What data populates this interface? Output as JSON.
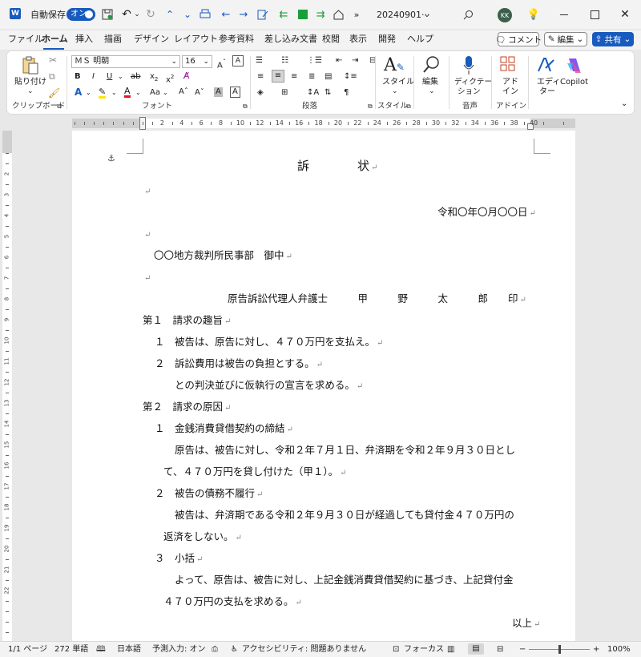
{
  "titlebar": {
    "autosave_label": "自動保存",
    "autosave_state": "オン",
    "doc_name": "20240901···",
    "avatar": "KK",
    "app_icon": "word-icon"
  },
  "tabs": [
    {
      "label": "ファイル"
    },
    {
      "label": "ホーム"
    },
    {
      "label": "挿入"
    },
    {
      "label": "描画"
    },
    {
      "label": "デザイン"
    },
    {
      "label": "レイアウト"
    },
    {
      "label": "参考資料"
    },
    {
      "label": "差し込み文書"
    },
    {
      "label": "校閲"
    },
    {
      "label": "表示"
    },
    {
      "label": "開発"
    },
    {
      "label": "ヘルプ"
    }
  ],
  "header_buttons": {
    "comment": "コメント",
    "edit": "編集",
    "share": "共有"
  },
  "ribbon": {
    "paste": "貼り付け",
    "font_name": "ＭＳ 明朝",
    "font_size": "16",
    "groups": {
      "clipboard": "クリップボード",
      "font": "フォント",
      "paragraph": "段落",
      "style": "スタイル",
      "voice": "音声",
      "addin": "アドイン"
    },
    "style_btn": "スタイル",
    "edit_btn": "編集",
    "dictate_line1": "ディクテー",
    "dictate_line2": "ション",
    "addin_line1": "アド",
    "addin_line2": "イン",
    "editor_line1": "エディ",
    "editor_line2": "ター",
    "copilot": "Copilot"
  },
  "ruler": {
    "labels": [
      "2",
      "4",
      "6",
      "8",
      "10",
      "12",
      "14",
      "16",
      "18",
      "20",
      "22",
      "24",
      "26",
      "28",
      "30",
      "32",
      "34",
      "36",
      "38",
      "40"
    ]
  },
  "vruler": {
    "labels": [
      "2",
      "3",
      "4",
      "5",
      "6",
      "7",
      "8",
      "9",
      "10",
      "11",
      "12",
      "13",
      "14",
      "15",
      "16",
      "17",
      "18",
      "19",
      "20",
      "21",
      "22"
    ]
  },
  "document": {
    "title": "訴　　　　状",
    "date": "令和〇年〇月〇〇日",
    "court": "〇〇地方裁判所民事部　御中",
    "attorney": "原告訴訟代理人弁護士　　　甲　　　野　　　太　　　郎　　印",
    "sec1": "第１　請求の趣旨",
    "s1_1": "１　被告は、原告に対し、４７０万円を支払え。",
    "s1_2": "２　訴訟費用は被告の負担とする。",
    "s1_3": "との判決並びに仮執行の宣言を求める。",
    "sec2": "第２　請求の原因",
    "s2_1h": "１　金銭消費貸借契約の締結",
    "s2_1a": "原告は、被告に対し、令和２年７月１日、弁済期を令和２年９月３０日とし",
    "s2_1b": "て、４７０万円を貸し付けた（甲１）。",
    "s2_2h": "２　被告の債務不履行",
    "s2_2a": "被告は、弁済期である令和２年９月３０日が経過しても貸付金４７０万円の",
    "s2_2b": "返済をしない。",
    "s2_3h": "３　小括",
    "s2_3a": "よって、原告は、被告に対し、上記金銭消費貸借契約に基づき、上記貸付金",
    "s2_3b": "４７０万円の支払を求める。",
    "closing": "以上"
  },
  "status": {
    "page": "1/1 ページ",
    "words": "272 単語",
    "lang": "日本語",
    "predict": "予測入力: オン",
    "access": "アクセシビリティ: 問題ありません",
    "focus": "フォーカス",
    "zoom": "100%",
    "zoom_level": 0.5
  },
  "colors": {
    "accent": "#185abd",
    "highlight": "#ffe600",
    "fontcolor": "#e81123"
  }
}
